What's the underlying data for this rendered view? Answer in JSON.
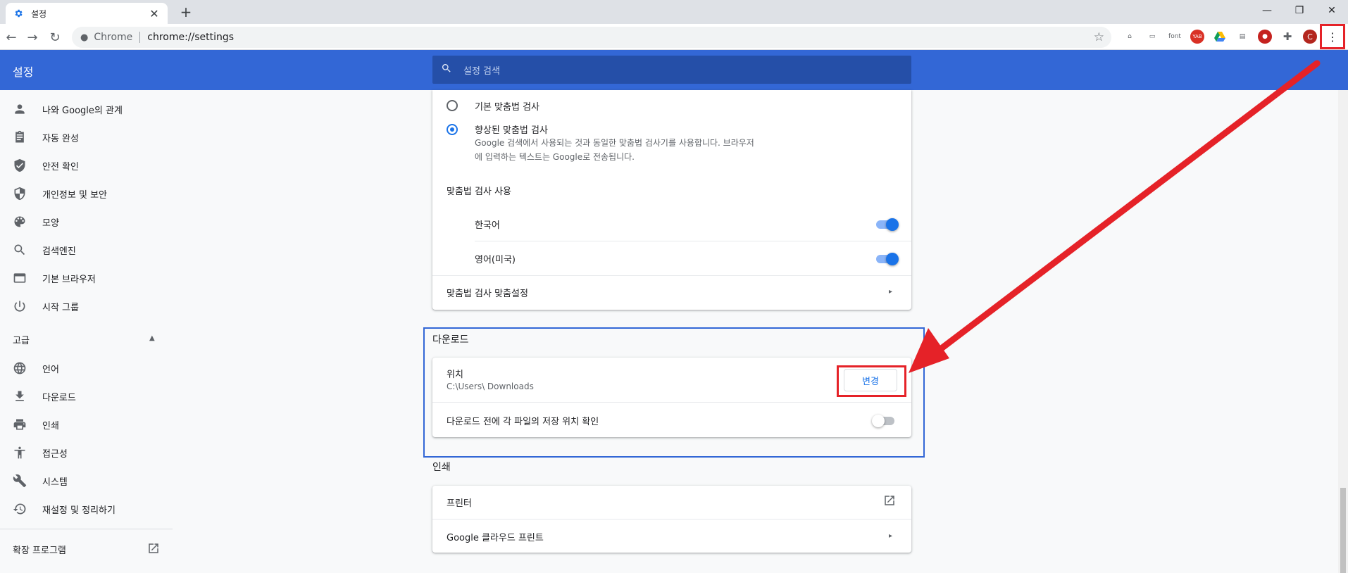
{
  "tab": {
    "title": "설정"
  },
  "toolbar": {
    "omnibox_prefix": "Chrome",
    "url": "chrome://settings",
    "extensions": [
      "pdf-icon",
      "cast-icon",
      "font",
      "yab-icon",
      "drive-icon",
      "image-icon",
      "record-icon",
      "puzzle-icon"
    ],
    "profile_initial": "C"
  },
  "header": {
    "title": "설정",
    "search_placeholder": "설정 검색"
  },
  "sidebar": {
    "items": [
      {
        "label": "나와 Google의 관계",
        "icon": "person-icon"
      },
      {
        "label": "자동 완성",
        "icon": "clipboard-icon"
      },
      {
        "label": "안전 확인",
        "icon": "shield-check-icon"
      },
      {
        "label": "개인정보 및 보안",
        "icon": "shield-icon"
      },
      {
        "label": "모양",
        "icon": "palette-icon"
      },
      {
        "label": "검색엔진",
        "icon": "search-icon"
      },
      {
        "label": "기본 브라우저",
        "icon": "browser-icon"
      },
      {
        "label": "시작 그룹",
        "icon": "power-icon"
      }
    ],
    "advanced_label": "고급",
    "advanced_items": [
      {
        "label": "언어",
        "icon": "globe-icon"
      },
      {
        "label": "다운로드",
        "icon": "download-icon"
      },
      {
        "label": "인쇄",
        "icon": "printer-icon"
      },
      {
        "label": "접근성",
        "icon": "accessibility-icon"
      },
      {
        "label": "시스템",
        "icon": "wrench-icon"
      },
      {
        "label": "재설정 및 정리하기",
        "icon": "history-icon"
      }
    ],
    "extensions_label": "확장 프로그램"
  },
  "spellcheck": {
    "basic_label": "기본 맞춤법 검사",
    "enhanced_label": "향상된 맞춤법 검사",
    "enhanced_desc_1": "Google 검색에서 사용되는 것과 동일한 맞춤법 검사기를 사용합니다. 브라우저",
    "enhanced_desc_2": "에 입력하는 텍스트는 Google로 전송됩니다.",
    "use_label": "맞춤법 검사 사용",
    "languages": [
      {
        "label": "한국어",
        "enabled": true
      },
      {
        "label": "영어(미국)",
        "enabled": true
      }
    ],
    "custom_label": "맞춤법 검사 맞춤설정"
  },
  "downloads": {
    "section_title": "다운로드",
    "location_label": "위치",
    "location_path": "C:\\Users\\        Downloads",
    "change_label": "변경",
    "ask_label": "다운로드 전에 각 파일의 저장 위치 확인",
    "ask_enabled": false
  },
  "printing": {
    "section_title": "인쇄",
    "printers_label": "프린터",
    "cloud_print_label": "Google 클라우드 프린트"
  },
  "colors": {
    "header": "#3367d6",
    "accent": "#1a73e8",
    "annotation": "#e52228"
  }
}
